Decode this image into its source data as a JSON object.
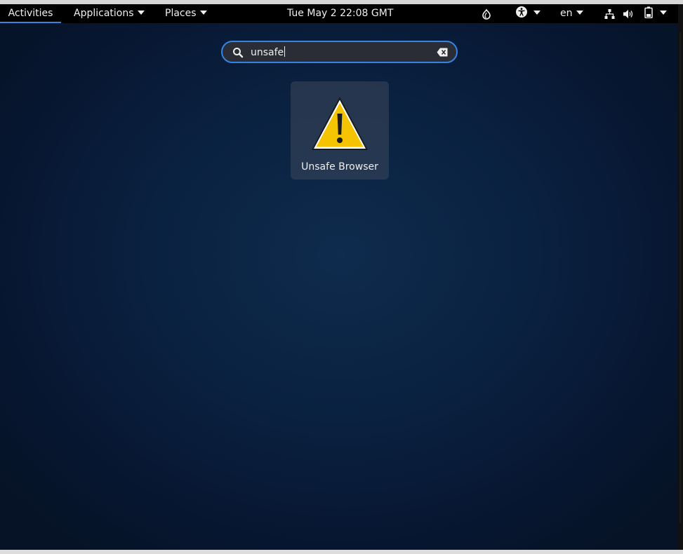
{
  "topbar": {
    "activities_label": "Activities",
    "applications_label": "Applications",
    "places_label": "Places",
    "clock": "Tue May 2  22:08 GMT",
    "language": "en"
  },
  "search": {
    "value": "unsafe"
  },
  "results": [
    {
      "label": "Unsafe Browser",
      "icon": "warning-icon"
    }
  ],
  "colors": {
    "accent": "#3584e4",
    "warning": "#f5c400"
  }
}
